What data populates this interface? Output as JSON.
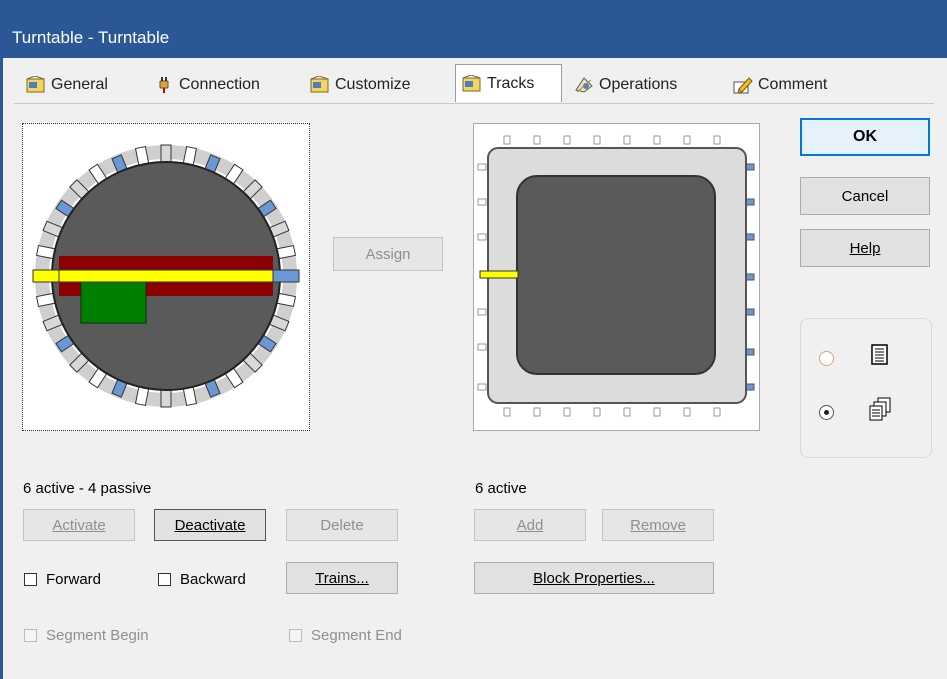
{
  "window": {
    "title": "Turntable - Turntable"
  },
  "tabs": [
    {
      "label": "General",
      "icon": "general-tab-icon"
    },
    {
      "label": "Connection",
      "icon": "plug-icon"
    },
    {
      "label": "Customize",
      "icon": "customize-tab-icon"
    },
    {
      "label": "Tracks",
      "icon": "tracks-tab-icon",
      "active": true
    },
    {
      "label": "Operations",
      "icon": "operations-tab-icon"
    },
    {
      "label": "Comment",
      "icon": "comment-pencil-icon"
    }
  ],
  "left": {
    "assign_label": "Assign",
    "status": "6 active - 4 passive",
    "activate_label": "Activate",
    "deactivate_label": "Deactivate",
    "delete_label": "Delete",
    "forward_label": "Forward",
    "backward_label": "Backward",
    "trains_label": "Trains...",
    "segment_begin_label": "Segment Begin",
    "segment_end_label": "Segment End"
  },
  "right": {
    "status": "6 active",
    "add_label": "Add",
    "remove_label": "Remove",
    "block_properties_label": "Block Properties..."
  },
  "dialog": {
    "ok_label": "OK",
    "cancel_label": "Cancel",
    "help_label": "Help"
  },
  "view_mode": {
    "options": [
      {
        "icon": "single-page-icon",
        "selected": false
      },
      {
        "icon": "multi-page-icon",
        "selected": true
      }
    ]
  },
  "colors": {
    "titlebar": "#2b5797",
    "ok_border": "#0078d7",
    "track_active": "#6a98d4",
    "bridge": "#ffff00",
    "turntable_pit": "#5a5a5a",
    "bridge_frame": "#8b0000",
    "locomotive": "#008000"
  }
}
